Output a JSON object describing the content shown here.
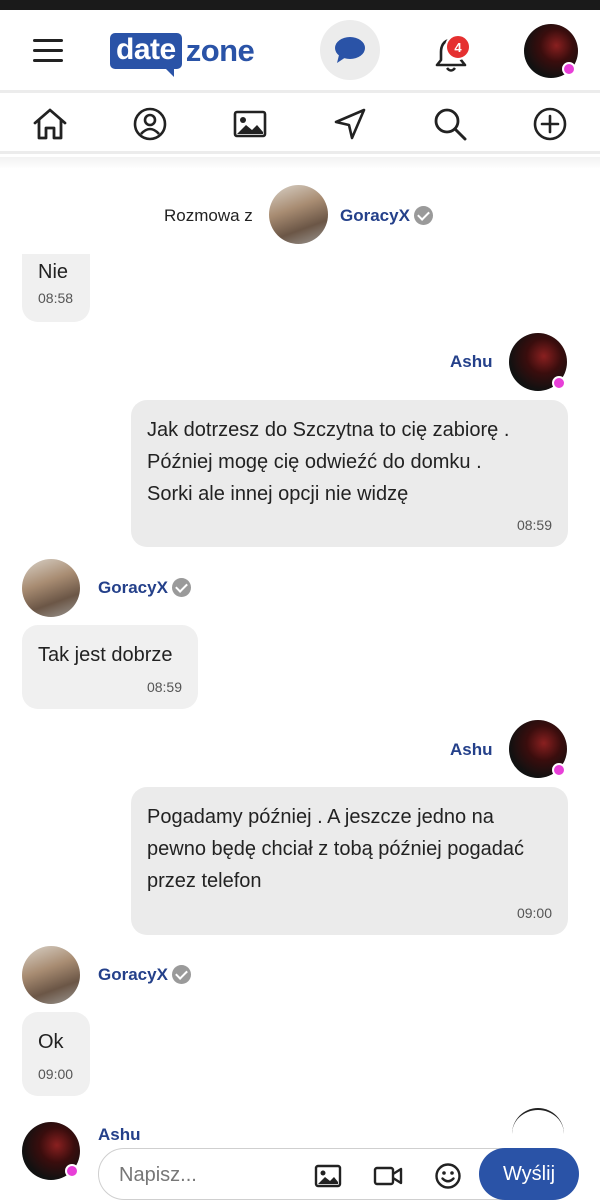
{
  "app": {
    "logo_part1": "date",
    "logo_part2": "zone",
    "notification_count": "4"
  },
  "icons": {
    "menu": "hamburger-icon",
    "messages": "chat-bubble-icon",
    "notifications": "bell-icon",
    "home": "home-icon",
    "profile": "user-circle-icon",
    "gallery": "image-icon",
    "nearby": "navigation-arrow-icon",
    "search": "search-icon",
    "add": "plus-circle-icon",
    "composer_image": "image-icon",
    "composer_video": "video-camera-icon",
    "composer_emoji": "smiley-icon"
  },
  "colors": {
    "brand": "#2a53a7",
    "name": "#24408a",
    "badge": "#e53030",
    "online": "#e83fd8",
    "bubble": "#f0f0f0"
  },
  "conversation": {
    "label": "Rozmowa z",
    "partner_name": "GoracyX"
  },
  "messages": [
    {
      "sender": "",
      "lines": [
        "Nie"
      ],
      "time": "08:58"
    },
    {
      "sender": "Ashu",
      "lines": [
        "Jak dotrzesz do Szczytna to cię zabiorę .",
        "Później mogę cię odwieźć do domku .",
        "Sorki ale innej opcji nie widzę"
      ],
      "time": "08:59"
    },
    {
      "sender": "GoracyX",
      "lines": [
        "Tak jest dobrze"
      ],
      "time": "08:59"
    },
    {
      "sender": "Ashu",
      "lines": [
        "Pogadamy później . A jeszcze jedno na",
        "pewno będę chciał z tobą później pogadać",
        "przez telefon"
      ],
      "time": "09:00"
    },
    {
      "sender": "GoracyX",
      "lines": [
        "Ok"
      ],
      "time": "09:00"
    },
    {
      "sender": "Ashu",
      "lines": [],
      "time": ""
    }
  ],
  "composer": {
    "placeholder": "Napisz...",
    "send_label": "Wyślij"
  }
}
